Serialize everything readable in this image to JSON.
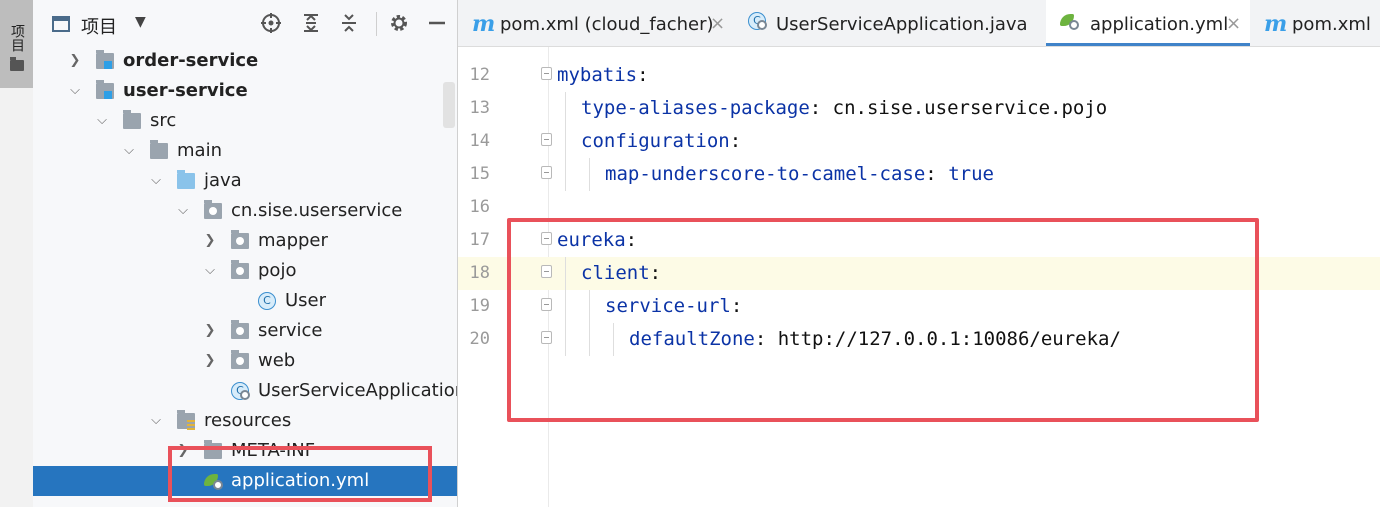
{
  "tool_strip": {
    "project_tab_label": "项目"
  },
  "project_panel": {
    "title": "项目",
    "dropdown_glyph": "▼",
    "toolbar_icons": [
      "crosshair-icon",
      "expand-all-icon",
      "collapse-all-icon",
      "gear-icon",
      "minimize-icon"
    ],
    "tree": [
      {
        "label": "order-service",
        "indent": 0,
        "chevron": "›",
        "icon": "module-folder-icon",
        "bold": true
      },
      {
        "label": "user-service",
        "indent": 0,
        "chevron": "⌄",
        "icon": "module-folder-icon",
        "bold": true
      },
      {
        "label": "src",
        "indent": 1,
        "chevron": "⌄",
        "icon": "folder-icon"
      },
      {
        "label": "main",
        "indent": 2,
        "chevron": "⌄",
        "icon": "folder-icon"
      },
      {
        "label": "java",
        "indent": 3,
        "chevron": "⌄",
        "icon": "source-folder-icon"
      },
      {
        "label": "cn.sise.userservice",
        "indent": 4,
        "chevron": "⌄",
        "icon": "package-icon"
      },
      {
        "label": "mapper",
        "indent": 5,
        "chevron": "›",
        "icon": "package-icon"
      },
      {
        "label": "pojo",
        "indent": 5,
        "chevron": "⌄",
        "icon": "package-icon"
      },
      {
        "label": "User",
        "indent": 6,
        "chevron": "",
        "icon": "class-icon"
      },
      {
        "label": "service",
        "indent": 5,
        "chevron": "›",
        "icon": "package-icon"
      },
      {
        "label": "web",
        "indent": 5,
        "chevron": "›",
        "icon": "package-icon"
      },
      {
        "label": "UserServiceApplication",
        "indent": 5,
        "chevron": "",
        "icon": "spring-boot-class-icon"
      },
      {
        "label": "resources",
        "indent": 3,
        "chevron": "⌄",
        "icon": "resources-folder-icon"
      },
      {
        "label": "META-INF",
        "indent": 4,
        "chevron": "›",
        "icon": "folder-icon"
      },
      {
        "label": "application.yml",
        "indent": 4,
        "chevron": "",
        "icon": "spring-yaml-icon",
        "selected": true
      }
    ]
  },
  "editor": {
    "tabs": [
      {
        "label": "pom.xml (cloud_facher)",
        "icon": "maven-icon",
        "active": false,
        "close": "×"
      },
      {
        "label": "UserServiceApplication.java",
        "icon": "spring-boot-class-icon",
        "active": false,
        "close": ""
      },
      {
        "label": "application.yml",
        "icon": "spring-yaml-icon",
        "active": true,
        "close": "×"
      },
      {
        "label": "pom.xml",
        "icon": "maven-icon",
        "active": false,
        "close": ""
      }
    ],
    "lines": [
      {
        "num": "12",
        "indent": 0,
        "key": "mybatis",
        "sep": ":",
        "value": "",
        "fold": true
      },
      {
        "num": "13",
        "indent": 1,
        "key": "type-aliases-package",
        "sep": ":",
        "value": " cn.sise.userservice.pojo",
        "fold": false
      },
      {
        "num": "14",
        "indent": 1,
        "key": "configuration",
        "sep": ":",
        "value": "",
        "fold": true
      },
      {
        "num": "15",
        "indent": 2,
        "key": "map-underscore-to-camel-case",
        "sep": ":",
        "value": "",
        "bool": " true",
        "fold": true
      },
      {
        "num": "16",
        "indent": 0,
        "key": "",
        "sep": "",
        "value": "",
        "fold": false
      },
      {
        "num": "17",
        "indent": 0,
        "key": "eureka",
        "sep": ":",
        "value": "",
        "fold": true
      },
      {
        "num": "18",
        "indent": 1,
        "key": "client",
        "sep": ":",
        "value": "",
        "fold": true,
        "current": true
      },
      {
        "num": "19",
        "indent": 2,
        "key": "service-url",
        "sep": ":",
        "value": "",
        "fold": true
      },
      {
        "num": "20",
        "indent": 3,
        "key": "defaultZone",
        "sep": ":",
        "value": " http://127.0.0.1:10086/eureka/",
        "fold": true
      }
    ]
  },
  "colors": {
    "accent": "#2675bf",
    "highlight_box": "#e9515a",
    "yaml_key": "#0b33a6"
  }
}
